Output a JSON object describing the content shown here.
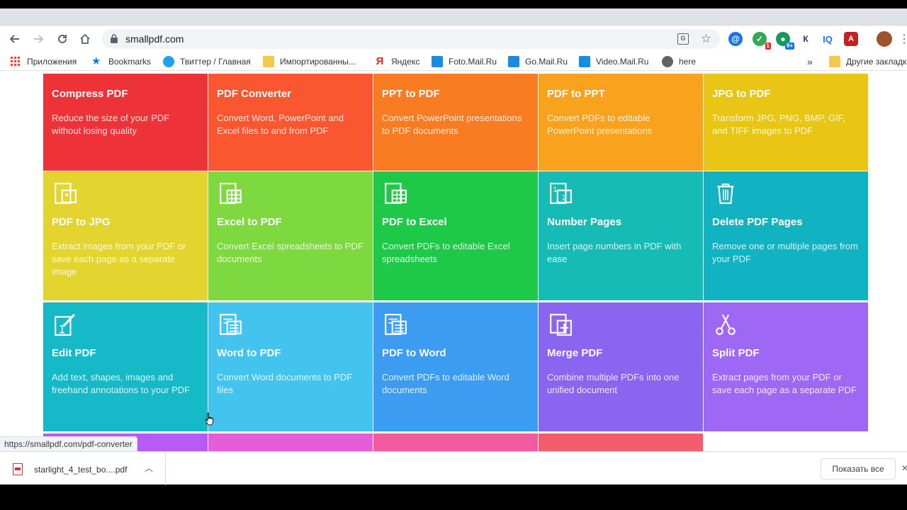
{
  "browser": {
    "url": "smallpdf.com",
    "hover_link": "https://smallpdf.com/pdf-converter"
  },
  "bookmarks": {
    "apps": "Приложения",
    "items": [
      "Bookmarks",
      "Твиттер / Главная",
      "Импортированны...",
      "Яндекс",
      "Foto.Mail.Ru",
      "Go.Mail.Ru",
      "Video.Mail.Ru",
      "here"
    ],
    "overflow": "»",
    "other": "Другие закладк"
  },
  "extensions": {
    "badge_1": "1",
    "badge_2": "9+",
    "iq": "IQ",
    "k": "К"
  },
  "tools": [
    {
      "title": "Compress PDF",
      "desc": "Reduce the size of your PDF without losing quality",
      "color": "#ee3338",
      "icon": "compress-icon"
    },
    {
      "title": "PDF Converter",
      "desc": "Convert Word, PowerPoint and Excel files to and from PDF",
      "color": "#fa5630",
      "icon": "converter-icon"
    },
    {
      "title": "PPT to PDF",
      "desc": "Convert PowerPoint presentations to PDF documents",
      "color": "#f97c22",
      "icon": "ppt-icon"
    },
    {
      "title": "PDF to PPT",
      "desc": "Convert PDFs to editable PowerPoint presentations",
      "color": "#f9a21e",
      "icon": "ppt-icon"
    },
    {
      "title": "JPG to PDF",
      "desc": "Transform JPG, PNG, BMP, GIF, and TIFF images to PDF",
      "color": "#e9c515",
      "icon": "image-icon"
    },
    {
      "title": "PDF to JPG",
      "desc": "Extract images from your PDF or save each page as a separate image",
      "color": "#e4d42f",
      "icon": "image-icon"
    },
    {
      "title": "Excel to PDF",
      "desc": "Convert Excel spreadsheets to PDF documents",
      "color": "#7ed840",
      "icon": "spreadsheet-icon"
    },
    {
      "title": "PDF to Excel",
      "desc": "Convert PDFs to editable Excel spreadsheets",
      "color": "#1ec948",
      "icon": "spreadsheet-icon"
    },
    {
      "title": "Number Pages",
      "desc": "Insert page numbers in PDF with ease",
      "color": "#16bbb6",
      "icon": "number-pages-icon"
    },
    {
      "title": "Delete PDF Pages",
      "desc": "Remove one or multiple pages from your PDF",
      "color": "#11b2c1",
      "icon": "trash-icon"
    },
    {
      "title": "Edit PDF",
      "desc": "Add text, shapes, images and freehand annotations to your PDF",
      "color": "#16b9c7",
      "icon": "edit-icon"
    },
    {
      "title": "Word to PDF",
      "desc": "Convert Word documents to PDF files",
      "color": "#42c4ee",
      "icon": "document-icon"
    },
    {
      "title": "PDF to Word",
      "desc": "Convert PDFs to editable Word documents",
      "color": "#3b9cf1",
      "icon": "document-icon"
    },
    {
      "title": "Merge PDF",
      "desc": "Combine multiple PDFs into one unified document",
      "color": "#8a65ef",
      "icon": "merge-icon"
    },
    {
      "title": "Split PDF",
      "desc": "Extract pages from your PDF or save each page as a separate PDF",
      "color": "#9e67f4",
      "icon": "scissors-icon"
    }
  ],
  "partial_tiles": [
    {
      "color": "#b65cf5"
    },
    {
      "color": "#e35ed8"
    },
    {
      "color": "#f15a9e"
    },
    {
      "color": "#f35c6b"
    }
  ],
  "downloads": {
    "file": "starlight_4_test_bo....pdf",
    "show_all": "Показать все"
  }
}
